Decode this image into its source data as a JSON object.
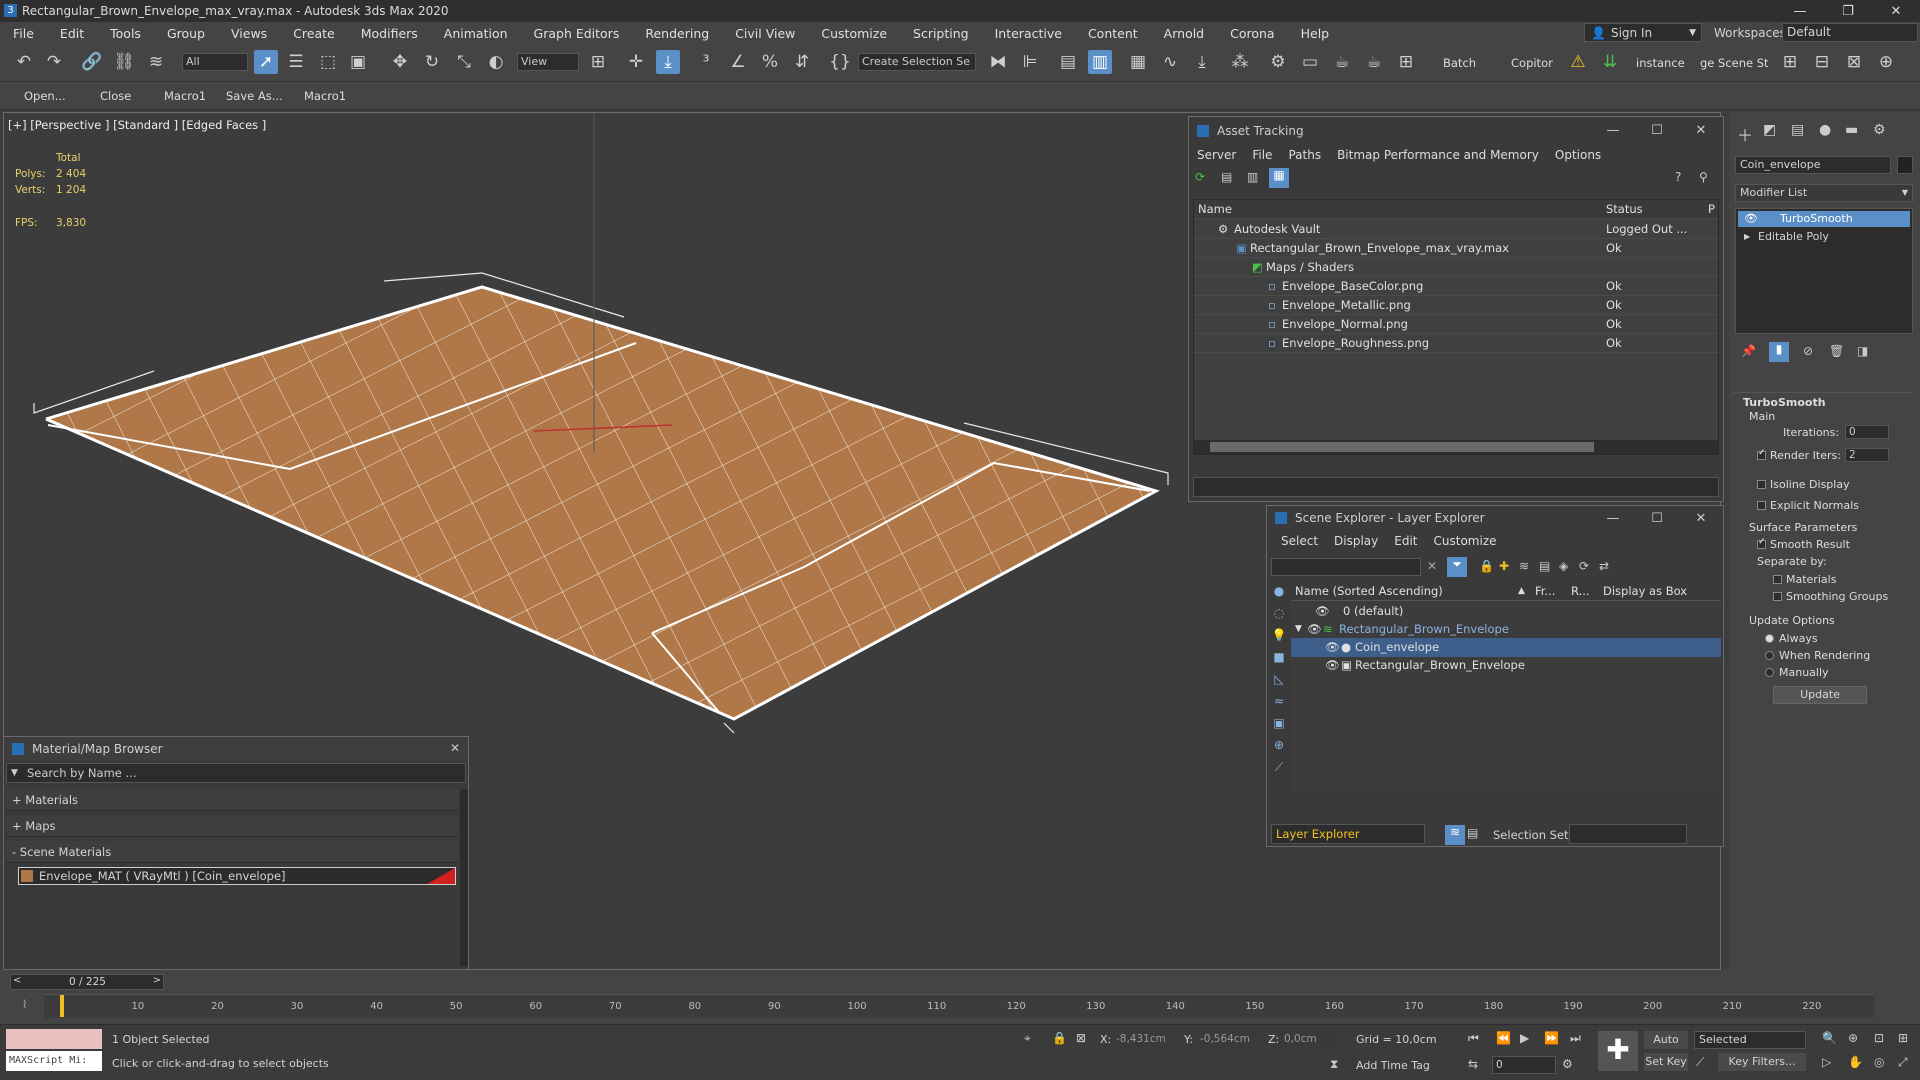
{
  "window": {
    "title": "Rectangular_Brown_Envelope_max_vray.max - Autodesk 3ds Max 2020"
  },
  "menu": [
    "File",
    "Edit",
    "Tools",
    "Group",
    "Views",
    "Create",
    "Modifiers",
    "Animation",
    "Graph Editors",
    "Rendering",
    "Civil View",
    "Customize",
    "Scripting",
    "Interactive",
    "Content",
    "Arnold",
    "Corona",
    "Help"
  ],
  "account": {
    "sign_in": "Sign In",
    "workspaces_label": "Workspaces:",
    "workspace": "Default"
  },
  "toolbar": {
    "filter": "All",
    "view": "View",
    "selection_set": "Create Selection Se",
    "batch": "Batch",
    "copitor": "Copitor",
    "instance": "instance",
    "scene_state": "ge Scene Stat"
  },
  "toolbar2": [
    "Open...",
    "Close",
    "Macro1",
    "Save As...",
    "Macro1"
  ],
  "viewport": {
    "label": "[+] [Perspective ] [Standard ] [Edged Faces ]",
    "stats": {
      "total_label": "Total",
      "polys_label": "Polys:",
      "polys": "2 404",
      "verts_label": "Verts:",
      "verts": "1 204",
      "fps_label": "FPS:",
      "fps": "3,830"
    }
  },
  "asset_tracking": {
    "title": "Asset Tracking",
    "menu": [
      "Server",
      "File",
      "Paths",
      "Bitmap Performance and Memory",
      "Options"
    ],
    "columns": [
      "Name",
      "Status",
      "P"
    ],
    "rows": [
      {
        "name": "Autodesk Vault",
        "status": "Logged Out ..."
      },
      {
        "name": "Rectangular_Brown_Envelope_max_vray.max",
        "status": "Ok"
      },
      {
        "name": "Maps / Shaders",
        "status": ""
      },
      {
        "name": "Envelope_BaseColor.png",
        "status": "Ok"
      },
      {
        "name": "Envelope_Metallic.png",
        "status": "Ok"
      },
      {
        "name": "Envelope_Normal.png",
        "status": "Ok"
      },
      {
        "name": "Envelope_Roughness.png",
        "status": "Ok"
      }
    ]
  },
  "scene_explorer": {
    "title": "Scene Explorer - Layer Explorer",
    "menu": [
      "Select",
      "Display",
      "Edit",
      "Customize"
    ],
    "columns": [
      "Name (Sorted Ascending)",
      "Fr...",
      "R...",
      "Display as Box"
    ],
    "rows": [
      {
        "name": "0 (default)"
      },
      {
        "name": "Rectangular_Brown_Envelope"
      },
      {
        "name": "Coin_envelope"
      },
      {
        "name": "Rectangular_Brown_Envelope"
      }
    ],
    "explorer": "Layer Explorer",
    "selection_set_label": "Selection Set:"
  },
  "material_browser": {
    "title": "Material/Map Browser",
    "search_placeholder": "Search by Name ...",
    "groups": [
      "+ Materials",
      "+ Maps",
      "- Scene Materials"
    ],
    "material": "Envelope_MAT ( VRayMtl ) [Coin_envelope]"
  },
  "command_panel": {
    "object_name": "Coin_envelope",
    "modifier_list": "Modifier List",
    "stack": [
      "TurboSmooth",
      "Editable Poly"
    ],
    "rollout": "TurboSmooth",
    "main": "Main",
    "iterations_label": "Iterations:",
    "iterations": "0",
    "render_iters_label": "Render Iters:",
    "render_iters": "2",
    "isoline": "Isoline Display",
    "explicit": "Explicit Normals",
    "surface_params": "Surface Parameters",
    "smooth_result": "Smooth Result",
    "separate_by": "Separate by:",
    "materials": "Materials",
    "smoothing_groups": "Smoothing Groups",
    "update_options": "Update Options",
    "always": "Always",
    "when_rendering": "When Rendering",
    "manually": "Manually",
    "update": "Update"
  },
  "timeline": {
    "frame": "0 / 225",
    "ticks": [
      "10",
      "20",
      "30",
      "40",
      "50",
      "60",
      "70",
      "80",
      "90",
      "100",
      "110",
      "120",
      "130",
      "140",
      "150",
      "160",
      "170",
      "180",
      "190",
      "200",
      "210",
      "220"
    ]
  },
  "status": {
    "script": "MAXScript Mi:",
    "selected": "1 Object Selected",
    "prompt": "Click or click-and-drag to select objects",
    "x_label": "X:",
    "x": "-8,431cm",
    "y_label": "Y:",
    "y": "-0,564cm",
    "z_label": "Z:",
    "z": "0,0cm",
    "grid": "Grid = 10,0cm",
    "add_time_tag": "Add Time Tag",
    "auto_key": "Auto Key",
    "set_key": "Set Key",
    "key_mode": "Selected",
    "key_filters": "Key Filters...",
    "frame_value": "0"
  },
  "colors": {
    "accent": "#5b8fc7",
    "envelope": "#b07848",
    "selection_highlight": "#3e5f8c"
  }
}
